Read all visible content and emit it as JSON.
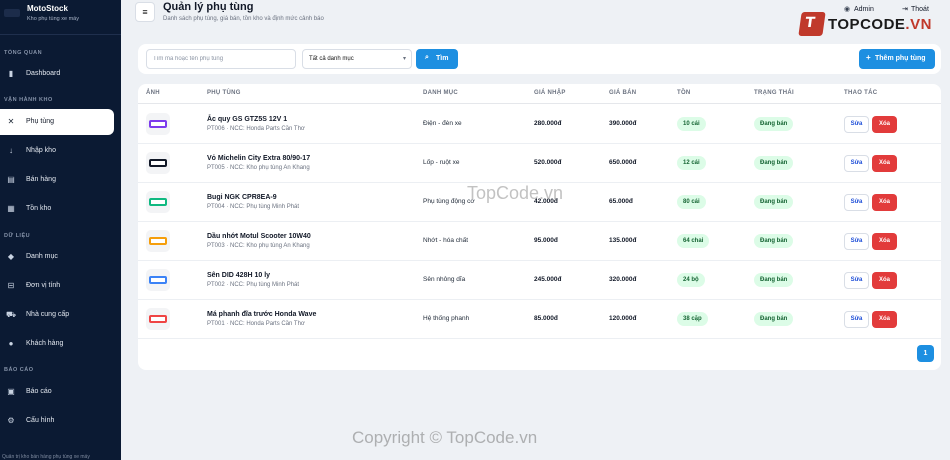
{
  "brand": {
    "name": "MotoStock",
    "subtitle": "Kho phụ tùng xe máy"
  },
  "sidebar": {
    "sections": [
      {
        "title": "TỔNG QUAN",
        "items": [
          {
            "label": "Dashboard",
            "icon": "chart-icon",
            "glyph": "▮"
          }
        ]
      },
      {
        "title": "VẬN HÀNH KHO",
        "items": [
          {
            "label": "Phụ tùng",
            "icon": "tools-icon",
            "glyph": "✕"
          },
          {
            "label": "Nhập kho",
            "icon": "arrow-down-icon",
            "glyph": "↓"
          },
          {
            "label": "Bán hàng",
            "icon": "register-icon",
            "glyph": "▤"
          },
          {
            "label": "Tồn kho",
            "icon": "boxes-icon",
            "glyph": "▦"
          }
        ]
      },
      {
        "title": "DỮ LIỆU",
        "items": [
          {
            "label": "Danh mục",
            "icon": "tags-icon",
            "glyph": "◆"
          },
          {
            "label": "Đơn vị tính",
            "icon": "ruler-icon",
            "glyph": "⊟"
          },
          {
            "label": "Nhà cung cấp",
            "icon": "truck-icon",
            "glyph": "⛟"
          },
          {
            "label": "Khách hàng",
            "icon": "users-icon",
            "glyph": "●"
          }
        ]
      },
      {
        "title": "BÁO CÁO",
        "items": [
          {
            "label": "Báo cáo",
            "icon": "report-icon",
            "glyph": "▣"
          },
          {
            "label": "Cấu hình",
            "icon": "gear-icon",
            "glyph": "⚙"
          }
        ]
      }
    ],
    "footer": "Quản trị kho bán hàng phụ tùng xe máy"
  },
  "header": {
    "menu_glyph": "≡",
    "title": "Quản lý phụ tùng",
    "subtitle": "Danh sách phụ tùng, giá bán, tồn kho và định mức cảnh báo",
    "admin_label": "Admin",
    "admin_glyph": "◉",
    "logout_label": "Thoát",
    "logout_glyph": "⇥"
  },
  "watermark": {
    "logo_badge": "T",
    "logo_text_1": "TOPCODE",
    "logo_text_2": ".VN",
    "center": "TopCode.vn",
    "footer": "Copyright © TopCode.vn"
  },
  "filters": {
    "search_placeholder": "Tìm mã hoặc tên phụ tùng",
    "category_selected": "Tất cả danh mục",
    "chevron_glyph": "▾",
    "search_button": "Tìm",
    "search_glyph": "⌕",
    "add_button": "Thêm phụ tùng",
    "add_glyph": "+"
  },
  "table": {
    "headers": [
      "ẢNH",
      "PHỤ TÙNG",
      "DANH MỤC",
      "GIÁ NHẬP",
      "GIÁ BÁN",
      "TỒN",
      "TRẠNG THÁI",
      "THAO TÁC"
    ],
    "edit_label": "Sửa",
    "delete_label": "Xóa",
    "rows": [
      {
        "name": "Ắc quy GS GTZ5S 12V 1",
        "meta": "PT006 · NCC: Honda Parts Cần Thơ",
        "category": "Điện - đèn xe",
        "cost": "280.000đ",
        "price": "390.000đ",
        "stock": "10 cái",
        "status": "Đang bán",
        "thumb_color": "#7c3aed"
      },
      {
        "name": "Vỏ Michelin City Extra 80/90-17",
        "meta": "PT005 · NCC: Kho phụ tùng An Khang",
        "category": "Lốp - ruột xe",
        "cost": "520.000đ",
        "price": "650.000đ",
        "stock": "12 cái",
        "status": "Đang bán",
        "thumb_color": "#111827"
      },
      {
        "name": "Bugi NGK CPR8EA-9",
        "meta": "PT004 · NCC: Phụ tùng Minh Phát",
        "category": "Phụ tùng động cơ",
        "cost": "42.000đ",
        "price": "65.000đ",
        "stock": "80 cái",
        "status": "Đang bán",
        "thumb_color": "#10b981"
      },
      {
        "name": "Dầu nhớt Motul Scooter 10W40",
        "meta": "PT003 · NCC: Kho phụ tùng An Khang",
        "category": "Nhớt - hóa chất",
        "cost": "95.000đ",
        "price": "135.000đ",
        "stock": "64 chai",
        "status": "Đang bán",
        "thumb_color": "#f59e0b"
      },
      {
        "name": "Sên DID 428H 10 ly",
        "meta": "PT002 · NCC: Phụ tùng Minh Phát",
        "category": "Sên nhông dĩa",
        "cost": "245.000đ",
        "price": "320.000đ",
        "stock": "24 bộ",
        "status": "Đang bán",
        "thumb_color": "#3b82f6"
      },
      {
        "name": "Má phanh đĩa trước Honda Wave",
        "meta": "PT001 · NCC: Honda Parts Cần Thơ",
        "category": "Hệ thống phanh",
        "cost": "85.000đ",
        "price": "120.000đ",
        "stock": "38 cặp",
        "status": "Đang bán",
        "thumb_color": "#ef4444"
      }
    ]
  },
  "pagination": {
    "current": "1"
  }
}
